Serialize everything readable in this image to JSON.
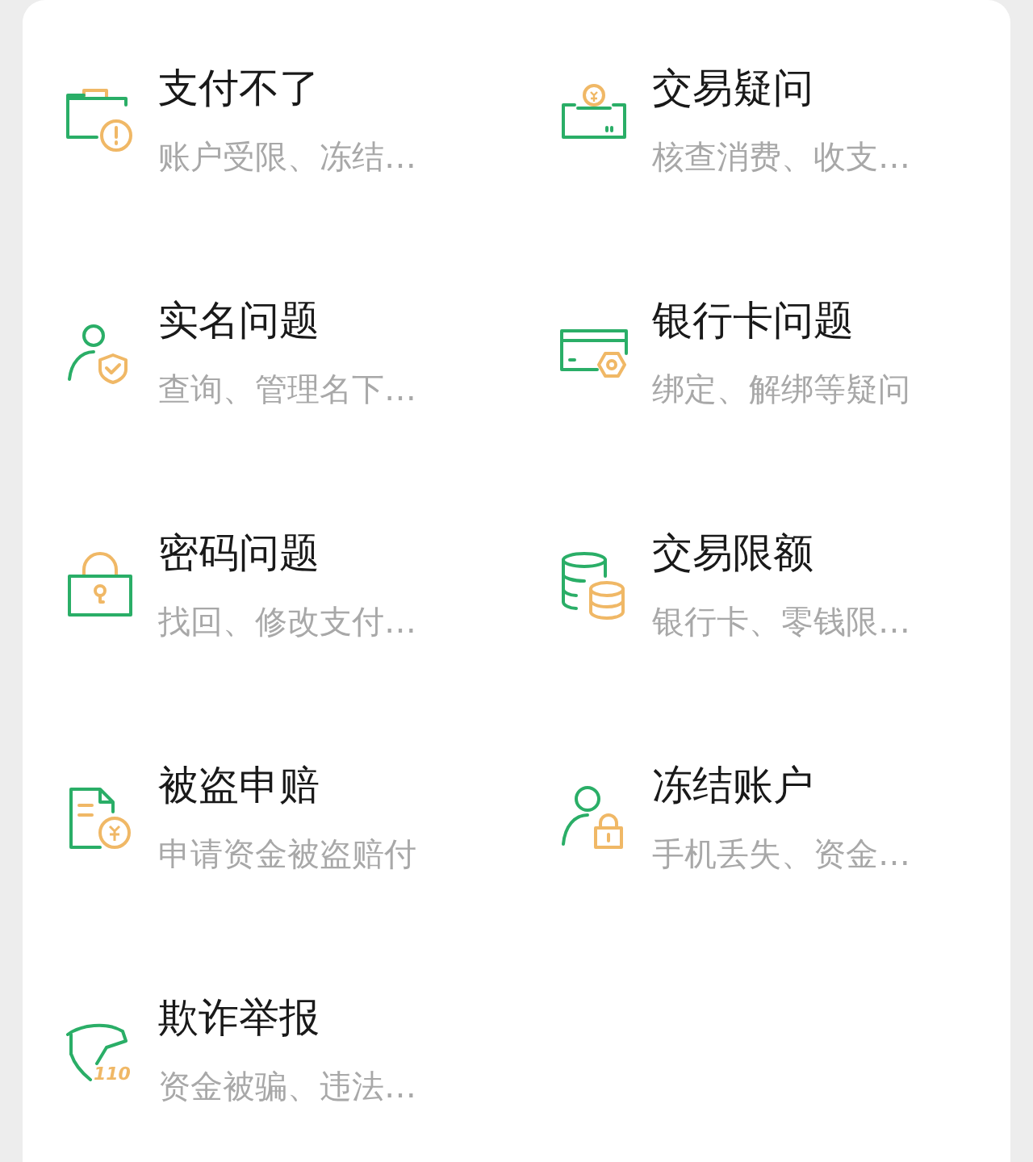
{
  "items": [
    {
      "kind": "wallet-alert",
      "title": "支付不了",
      "subtitle": "账户受限、冻结…"
    },
    {
      "kind": "coin-card",
      "title": "交易疑问",
      "subtitle": "核查消费、收支…"
    },
    {
      "kind": "person-shield",
      "title": "实名问题",
      "subtitle": "查询、管理名下…"
    },
    {
      "kind": "card-nut",
      "title": "银行卡问题",
      "subtitle": "绑定、解绑等疑问"
    },
    {
      "kind": "lock",
      "title": "密码问题",
      "subtitle": "找回、修改支付…"
    },
    {
      "kind": "coins",
      "title": "交易限额",
      "subtitle": "银行卡、零钱限…"
    },
    {
      "kind": "doc-coin",
      "title": "被盗申赔",
      "subtitle": "申请资金被盗赔付"
    },
    {
      "kind": "person-lock",
      "title": "冻结账户",
      "subtitle": "手机丢失、资金…"
    },
    {
      "kind": "shield-110",
      "title": "欺诈举报",
      "subtitle": "资金被骗、违法…",
      "badge": "110"
    }
  ]
}
